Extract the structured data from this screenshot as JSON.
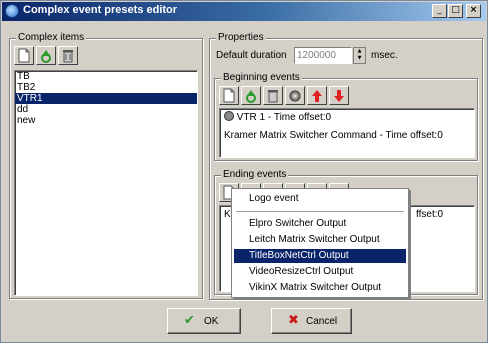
{
  "window": {
    "title": "Complex event presets editor",
    "controls": {
      "minimize": "_",
      "maximize": "□",
      "close": "×"
    }
  },
  "complex_items": {
    "legend": "Complex items",
    "toolbar": [
      "new-document-icon",
      "recycle-icon",
      "delete-icon"
    ],
    "items": [
      "TB",
      "TB2",
      "VTR1",
      "dd",
      "new"
    ],
    "selected": "VTR1"
  },
  "properties": {
    "legend": "Properties",
    "duration_label": "Default duration",
    "duration_value": "1200000",
    "duration_unit": "msec."
  },
  "beginning_events": {
    "legend": "Beginning events",
    "toolbar": [
      "new-document-icon",
      "recycle-icon",
      "delete-icon",
      "settings-icon",
      "arrow-up-icon",
      "arrow-down-icon"
    ],
    "items": [
      "VTR 1 - Time offset:0",
      "Kramer Matrix Switcher Command - Time offset:0"
    ]
  },
  "ending_events": {
    "legend": "Ending events",
    "items_visible": [
      {
        "left": "Kr",
        "right": "ffset:0"
      }
    ]
  },
  "popup_menu": {
    "items": [
      "Logo event",
      "Elpro Switcher Output",
      "Leitch Matrix Switcher Output",
      "TitleBoxNetCtrl Output",
      "VideoResizeCtrl Output",
      "VikinX Matrix Switcher Output"
    ],
    "highlighted": "TitleBoxNetCtrl Output"
  },
  "buttons": {
    "ok_label": "OK",
    "cancel_label": "Cancel"
  },
  "colors": {
    "selection": "#0a246a",
    "titlebar_start": "#0a246a",
    "face": "#d4d0c8",
    "arrow_red": "#e02020",
    "check_green": "#2a9a2a",
    "cancel_red": "#c81818"
  }
}
